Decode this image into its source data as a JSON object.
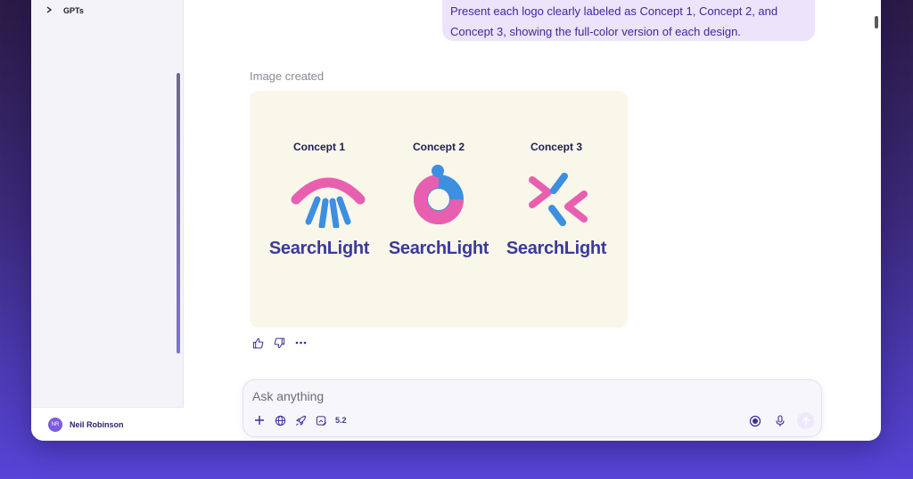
{
  "sidebar": {
    "gpts_label": "GPTs",
    "user": {
      "initials": "NR",
      "name": "Neil Robinson"
    }
  },
  "conversation": {
    "user_message": "Present each logo clearly labeled as Concept 1, Concept 2, and Concept 3, showing the full-color version of each design.",
    "image_status": "Image created",
    "concepts": [
      {
        "title": "Concept 1",
        "wordmark": "SearchLight"
      },
      {
        "title": "Concept 2",
        "wordmark": "SearchLight"
      },
      {
        "title": "Concept 3",
        "wordmark": "SearchLight"
      }
    ]
  },
  "composer": {
    "placeholder": "Ask anything",
    "model_label": "5.2"
  },
  "colors": {
    "brand_pink": "#e85fb0",
    "brand_blue": "#3d8fe0",
    "wordmark": "#3b3a9c",
    "accent": "#3b2a9a"
  },
  "icons": [
    "chevron-right-icon",
    "thumbs-up-icon",
    "thumbs-down-icon",
    "more-icon",
    "plus-icon",
    "globe-icon",
    "rocket-icon",
    "image-edit-icon",
    "voice-mode-icon",
    "microphone-icon",
    "send-arrow-icon"
  ]
}
